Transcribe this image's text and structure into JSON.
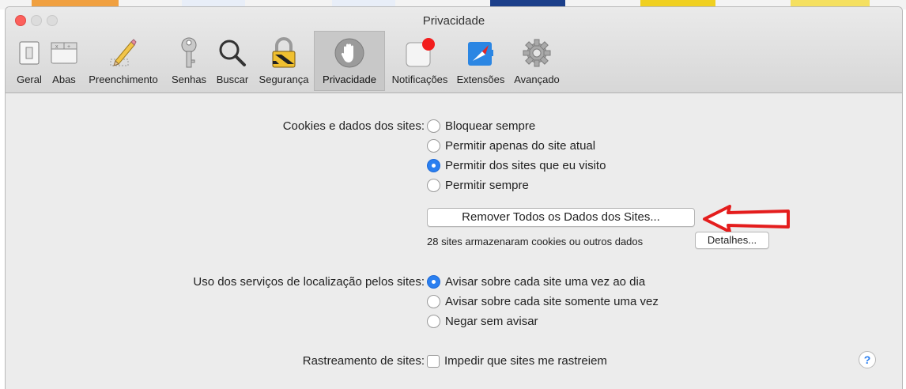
{
  "window": {
    "title": "Privacidade"
  },
  "toolbar": {
    "items": [
      {
        "label": "Geral",
        "icon": "switch-icon"
      },
      {
        "label": "Abas",
        "icon": "tabs-icon"
      },
      {
        "label": "Preenchimento",
        "icon": "pencil-icon"
      },
      {
        "label": "Senhas",
        "icon": "key-icon"
      },
      {
        "label": "Buscar",
        "icon": "magnifier-icon"
      },
      {
        "label": "Segurança",
        "icon": "lock-icon"
      },
      {
        "label": "Privacidade",
        "icon": "hand-icon",
        "active": true
      },
      {
        "label": "Notificações",
        "icon": "notification-badge-icon"
      },
      {
        "label": "Extensões",
        "icon": "extension-compass-icon"
      },
      {
        "label": "Avançado",
        "icon": "gear-icon"
      }
    ]
  },
  "cookies": {
    "label": "Cookies e dados dos sites:",
    "options": [
      {
        "label": "Bloquear sempre",
        "selected": false
      },
      {
        "label": "Permitir apenas do site atual",
        "selected": false
      },
      {
        "label": "Permitir dos sites que eu visito",
        "selected": true
      },
      {
        "label": "Permitir sempre",
        "selected": false
      }
    ],
    "remove_button": "Remover Todos os Dados dos Sites...",
    "stored_note": "28 sites armazenaram cookies ou outros dados",
    "details_button": "Detalhes..."
  },
  "location": {
    "label": "Uso dos serviços de localização pelos sites:",
    "options": [
      {
        "label": "Avisar sobre cada site uma vez ao dia",
        "selected": true
      },
      {
        "label": "Avisar sobre cada site somente uma vez",
        "selected": false
      },
      {
        "label": "Negar sem avisar",
        "selected": false
      }
    ]
  },
  "tracking": {
    "label": "Rastreamento de sites:",
    "checkbox_label": "Impedir que sites me rastreiem",
    "checked": false
  },
  "help": {
    "label": "?"
  },
  "colors": {
    "accent": "#2a7ff0",
    "annotation_arrow": "#e41d1d",
    "close_button": "#fc605c"
  }
}
